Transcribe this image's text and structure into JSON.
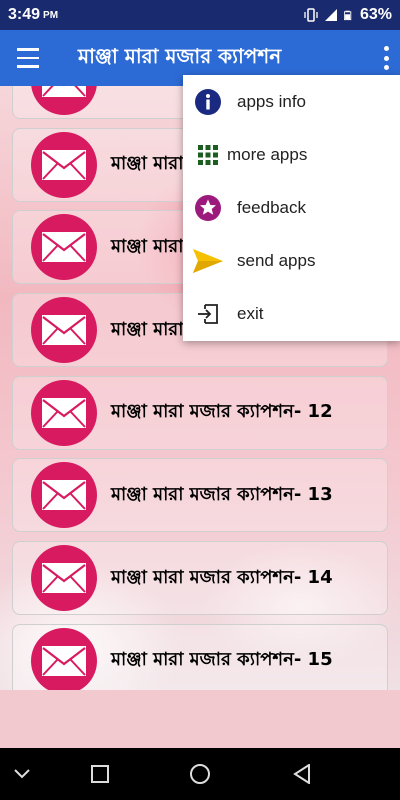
{
  "status_bar": {
    "time": "3:49",
    "ampm": "PM",
    "battery": "63%",
    "icons": [
      "vibrate-icon",
      "signal-icon",
      "battery-icon"
    ]
  },
  "app_bar": {
    "title": "মাঞ্জা মারা মজার ক্যাপশন",
    "menu_icon": "hamburger-icon",
    "overflow_icon": "more-vert-icon",
    "color": "#2c6bd6"
  },
  "list": {
    "icon": "envelope-icon",
    "icon_color": "#d81b60",
    "items": [
      {
        "label": ""
      },
      {
        "label": "মাঞ্জা মারা মজার ক্যাপশন- 8"
      },
      {
        "label": "মাঞ্জা মারা মজার ক্যাপশন- 9"
      },
      {
        "label": "মাঞ্জা মারা মজার ক্যাপশন- 10"
      },
      {
        "label": "মাঞ্জা মারা মজার ক্যাপশন- 12"
      },
      {
        "label": "মাঞ্জা মারা মজার ক্যাপশন- 13"
      },
      {
        "label": "মাঞ্জা মারা মজার ক্যাপশন- 14"
      },
      {
        "label": "মাঞ্জা মারা মজার ক্যাপশন- 15"
      }
    ]
  },
  "overflow_menu": {
    "items": [
      {
        "label": "apps info",
        "icon": "info-icon"
      },
      {
        "label": "more apps",
        "icon": "grid-icon"
      },
      {
        "label": "feedback",
        "icon": "star-icon"
      },
      {
        "label": "send apps",
        "icon": "send-icon"
      },
      {
        "label": "exit",
        "icon": "exit-icon"
      }
    ]
  },
  "nav_bar": {
    "icons": [
      "chevron-down-icon",
      "recents-icon",
      "home-icon",
      "back-icon"
    ]
  }
}
